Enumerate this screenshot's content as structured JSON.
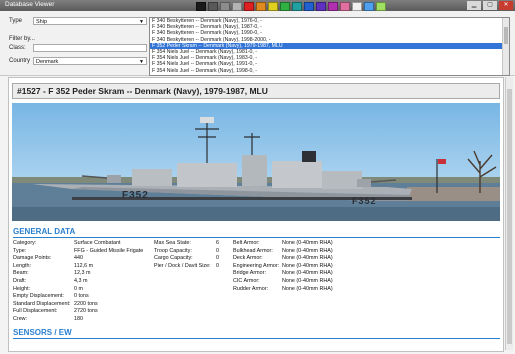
{
  "window": {
    "title": "Database Viewer",
    "palette": [
      "#1a1a1a",
      "#595959",
      "#8c8c8c",
      "#b3b3b3",
      "#e02020",
      "#e08a20",
      "#e0d020",
      "#30b040",
      "#20a0a0",
      "#2060d0",
      "#6030c0",
      "#b030b0",
      "#e070a0",
      "#f0f0f0",
      "#50a0f0",
      "#a0e060"
    ]
  },
  "filters": {
    "type_label": "Type",
    "type_value": "Ship",
    "filter_by_label": "Filter by...",
    "class_label": "Class:",
    "class_value": "",
    "country_label": "Country",
    "country_value": "Denmark"
  },
  "results": {
    "items": [
      "F 340 Beskytteren -- Denmark (Navy), 1976-0, -",
      "F 340 Beskytteren -- Denmark (Navy), 1987-0, -",
      "F 340 Beskytteren -- Denmark (Navy), 1990-0, -",
      "F 340 Beskytteren -- Denmark (Navy), 1998-2000, -",
      "F 352 Peder Skram -- Denmark (Navy), 1979-1987, MLU",
      "F 354 Niels Juel -- Denmark (Navy), 1981-0, -",
      "F 354 Niels Juel -- Denmark (Navy), 1983-0, -",
      "F 354 Niels Juel -- Denmark (Navy), 1991-0, -",
      "F 354 Niels Juel -- Denmark (Navy), 1998-0, -"
    ],
    "selected_index": 4,
    "scroll": {
      "thumb_start": 0.15,
      "thumb_size": 0.3
    }
  },
  "detail": {
    "title": "#1527 - F 352 Peder Skram -- Denmark (Navy), 1979-1987, MLU",
    "photo": {
      "hull_number": "F352"
    },
    "general_heading": "GENERAL DATA",
    "col1": [
      {
        "k": "Category:",
        "v": "Surface Combatant"
      },
      {
        "k": "Type:",
        "v": "FFG - Guided Missile Frigate"
      },
      {
        "k": "Damage Points:",
        "v": "440"
      },
      {
        "k": "Length:",
        "v": "112,6 m"
      },
      {
        "k": "Beam:",
        "v": "12,3 m"
      },
      {
        "k": "Draft:",
        "v": "4,3 m"
      },
      {
        "k": "Height:",
        "v": "0 m"
      },
      {
        "k": "Empty Displacement:",
        "v": "0 tons"
      },
      {
        "k": "Standard Displacement:",
        "v": "2200 tons"
      },
      {
        "k": "Full Displacement:",
        "v": "2720 tons"
      },
      {
        "k": "Crew:",
        "v": "180"
      }
    ],
    "col2": [
      {
        "k": "Max Sea State:",
        "v": "6"
      },
      {
        "k": "Troop Capacity:",
        "v": "0"
      },
      {
        "k": "Cargo Capacity:",
        "v": "0"
      },
      {
        "k": "Pier / Dock / Davit Size:",
        "v": "0"
      }
    ],
    "col3": [
      {
        "k": "Belt Armor:",
        "v": "None (0-40mm RHA)"
      },
      {
        "k": "Bulkhead Armor:",
        "v": "None (0-40mm RHA)"
      },
      {
        "k": "Deck Armor:",
        "v": "None (0-40mm RHA)"
      },
      {
        "k": "Engineering Armor:",
        "v": "None (0-40mm RHA)"
      },
      {
        "k": "Bridge Armor:",
        "v": "None (0-40mm RHA)"
      },
      {
        "k": "CIC Armor:",
        "v": "None (0-40mm RHA)"
      },
      {
        "k": "Rudder Armor:",
        "v": "None (0-40mm RHA)"
      }
    ],
    "sensors_heading": "SENSORS / EW"
  }
}
